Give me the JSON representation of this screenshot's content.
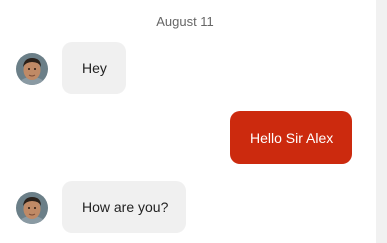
{
  "conversation": {
    "date_separator": "August 11",
    "messages": [
      {
        "direction": "incoming",
        "text": "Hey",
        "avatar": "contact-photo"
      },
      {
        "direction": "outgoing",
        "text": "Hello Sir Alex"
      },
      {
        "direction": "incoming",
        "text": "How are you?",
        "avatar": "contact-photo"
      }
    ]
  },
  "colors": {
    "outgoing_bubble": "#cc2a0e",
    "incoming_bubble": "#f0f0f0",
    "date_text": "#666666"
  }
}
